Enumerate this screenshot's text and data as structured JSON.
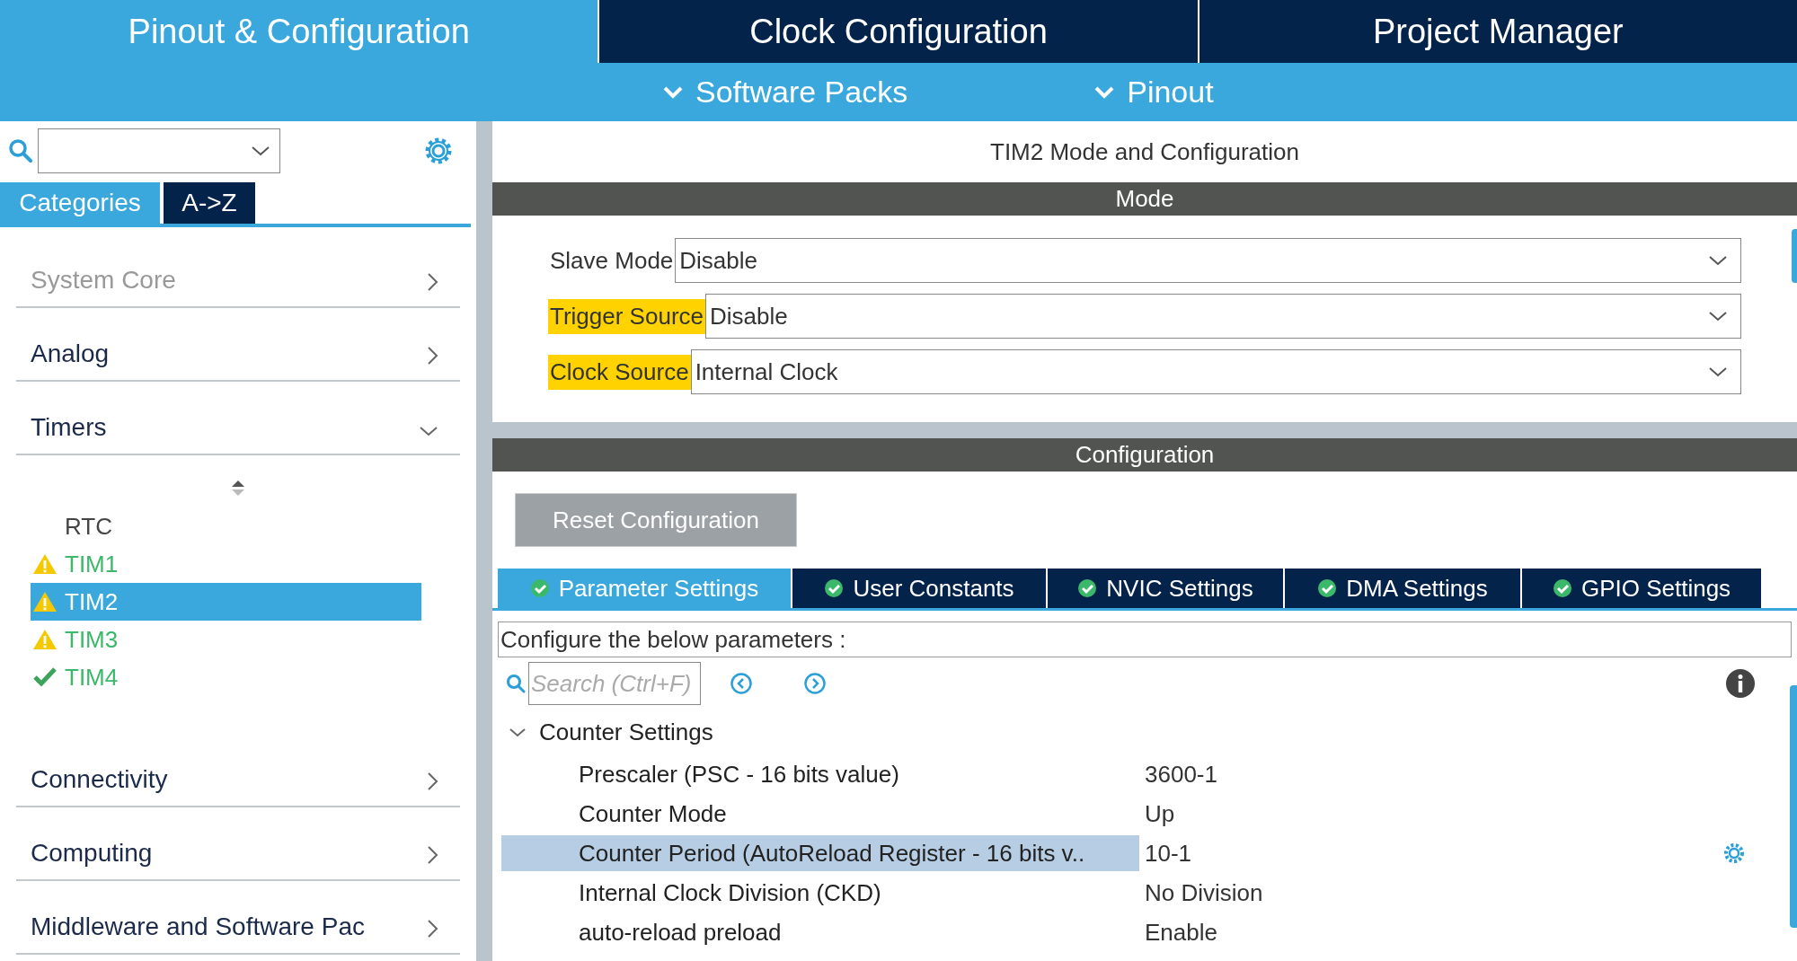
{
  "header_tabs": [
    {
      "label": "Pinout & Configuration",
      "selected": true
    },
    {
      "label": "Clock Configuration",
      "selected": false
    },
    {
      "label": "Project Manager",
      "selected": false
    }
  ],
  "sub_menu": [
    {
      "label": "Software Packs"
    },
    {
      "label": "Pinout"
    }
  ],
  "sidebar": {
    "tabs": [
      {
        "label": "Categories",
        "selected": true
      },
      {
        "label": "A->Z",
        "selected": false
      }
    ],
    "categories": [
      {
        "label": "System Core",
        "disabled": true,
        "expanded": false
      },
      {
        "label": "Analog",
        "disabled": false,
        "expanded": false
      },
      {
        "label": "Timers",
        "disabled": false,
        "expanded": true,
        "children": [
          {
            "label": "RTC",
            "kind": "plain",
            "selected": false
          },
          {
            "label": "TIM1",
            "kind": "warning",
            "selected": false
          },
          {
            "label": "TIM2",
            "kind": "warning",
            "selected": true
          },
          {
            "label": "TIM3",
            "kind": "warning",
            "selected": false
          },
          {
            "label": "TIM4",
            "kind": "ok",
            "selected": false
          }
        ]
      },
      {
        "label": "Connectivity",
        "disabled": false,
        "expanded": false
      },
      {
        "label": "Computing",
        "disabled": false,
        "expanded": false
      },
      {
        "label": "Middleware and Software Pac",
        "disabled": false,
        "expanded": false
      }
    ]
  },
  "mode_panel": {
    "title": "TIM2 Mode and Configuration",
    "header": "Mode",
    "rows": [
      {
        "label": "Slave Mode",
        "value": "Disable",
        "highlighted": false
      },
      {
        "label": "Trigger Source",
        "value": "Disable",
        "highlighted": true
      },
      {
        "label": "Clock Source",
        "value": "Internal Clock",
        "highlighted": true
      }
    ]
  },
  "config_panel": {
    "header": "Configuration",
    "reset_button": "Reset Configuration",
    "tabs": [
      {
        "label": "Parameter Settings",
        "selected": true
      },
      {
        "label": "User Constants",
        "selected": false
      },
      {
        "label": "NVIC Settings",
        "selected": false
      },
      {
        "label": "DMA Settings",
        "selected": false
      },
      {
        "label": "GPIO Settings",
        "selected": false
      }
    ],
    "description": "Configure the below parameters :",
    "search": {
      "placeholder": "Search (Ctrl+F)"
    },
    "groups": [
      {
        "label": "Counter Settings",
        "expanded": true,
        "children": [
          {
            "name": "Prescaler (PSC - 16 bits value)",
            "value": "3600-1",
            "selected": false
          },
          {
            "name": "Counter Mode",
            "value": "Up",
            "selected": false
          },
          {
            "name": "Counter Period (AutoReload Register - 16 bits v..",
            "value": "10-1",
            "selected": true
          },
          {
            "name": "Internal Clock Division (CKD)",
            "value": "No Division",
            "selected": false
          },
          {
            "name": "auto-reload preload",
            "value": "Enable",
            "selected": false
          }
        ]
      }
    ]
  }
}
